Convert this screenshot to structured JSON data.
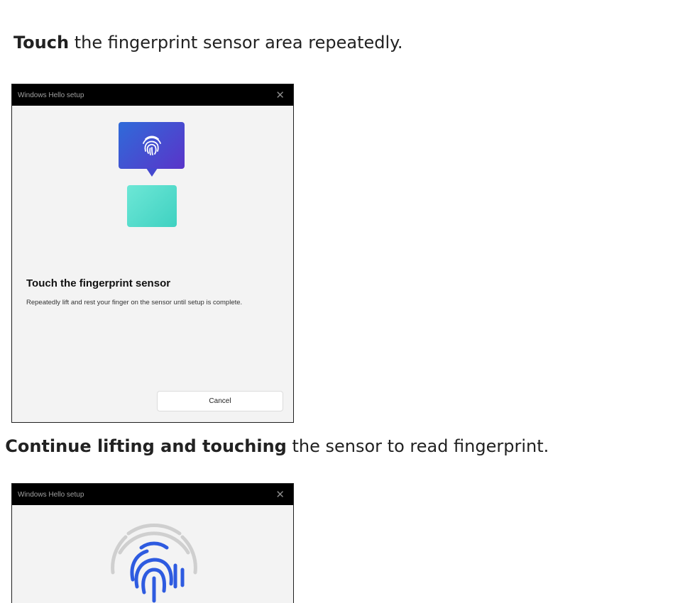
{
  "steps": [
    {
      "bold": "Touch",
      "rest": " the fingerprint sensor area repeatedly."
    },
    {
      "prefix": ". ",
      "bold": "Continue lifting and touching",
      "rest": " the sensor to read fingerprint."
    }
  ],
  "dialog1": {
    "title": "Windows Hello setup",
    "close": "✕",
    "heading": "Touch the fingerprint sensor",
    "body": "Repeatedly lift and rest your finger on the sensor until setup is complete.",
    "cancel": "Cancel"
  },
  "dialog2": {
    "title": "Windows Hello setup",
    "close": "✕"
  },
  "colors": {
    "bubble_start": "#2f6bd9",
    "bubble_end": "#5a34c9",
    "sensor": "#4fdcca",
    "fingerprint_blue": "#2e5be0"
  }
}
